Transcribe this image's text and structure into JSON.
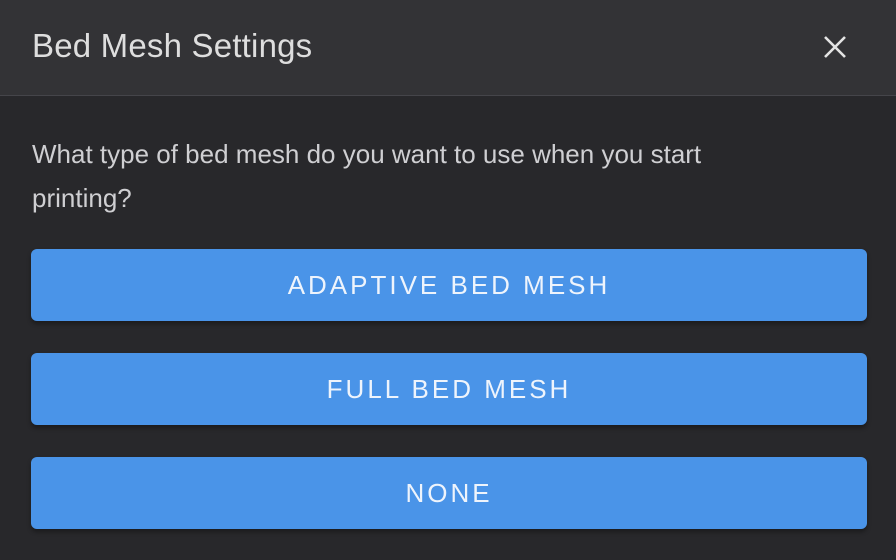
{
  "dialog": {
    "title": "Bed Mesh Settings",
    "close_icon": "close-icon",
    "message": "What type of bed mesh do you want to use when you start printing?",
    "options": [
      {
        "label": "ADAPTIVE BED MESH"
      },
      {
        "label": "FULL BED MESH"
      },
      {
        "label": "NONE"
      }
    ]
  },
  "colors": {
    "background": "#28282b",
    "header": "#333336",
    "button": "#4a94e8",
    "button_text": "#eef4fc"
  }
}
